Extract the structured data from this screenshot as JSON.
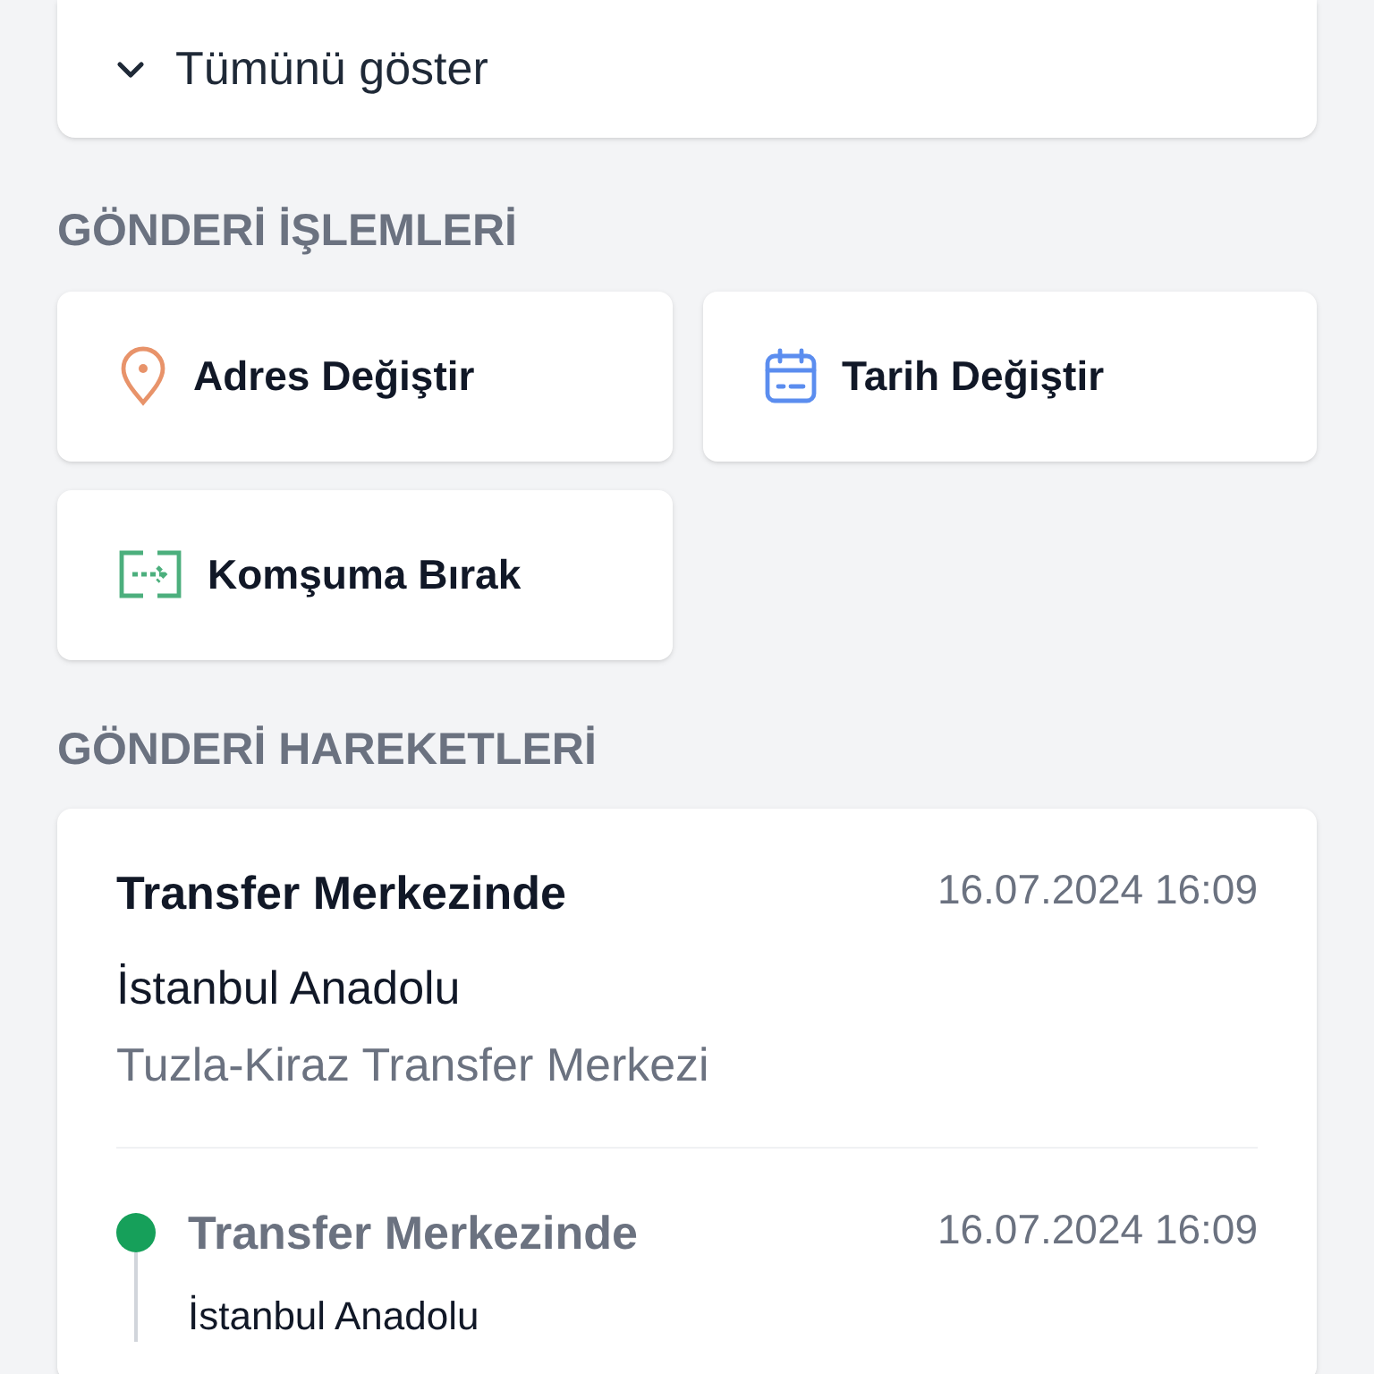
{
  "show_all": {
    "label": "Tümünü göster",
    "expanded": false
  },
  "actions_section": {
    "title": "GÖNDERİ İŞLEMLERİ",
    "actions": [
      {
        "kind": "address",
        "label": "Adres Değiştir"
      },
      {
        "kind": "date",
        "label": "Tarih Değiştir"
      },
      {
        "kind": "neighbor",
        "label": "Komşuma Bırak"
      }
    ]
  },
  "movements_section": {
    "title": "GÖNDERİ HAREKETLERİ",
    "latest": {
      "title": "Transfer Merkezinde",
      "date": "16.07.2024 16:09",
      "city": "İstanbul Anadolu",
      "location": "Tuzla-Kiraz Transfer Merkezi"
    },
    "history": [
      {
        "title": "Transfer Merkezinde",
        "date": "16.07.2024 16:09",
        "city": "İstanbul Anadolu"
      }
    ]
  }
}
